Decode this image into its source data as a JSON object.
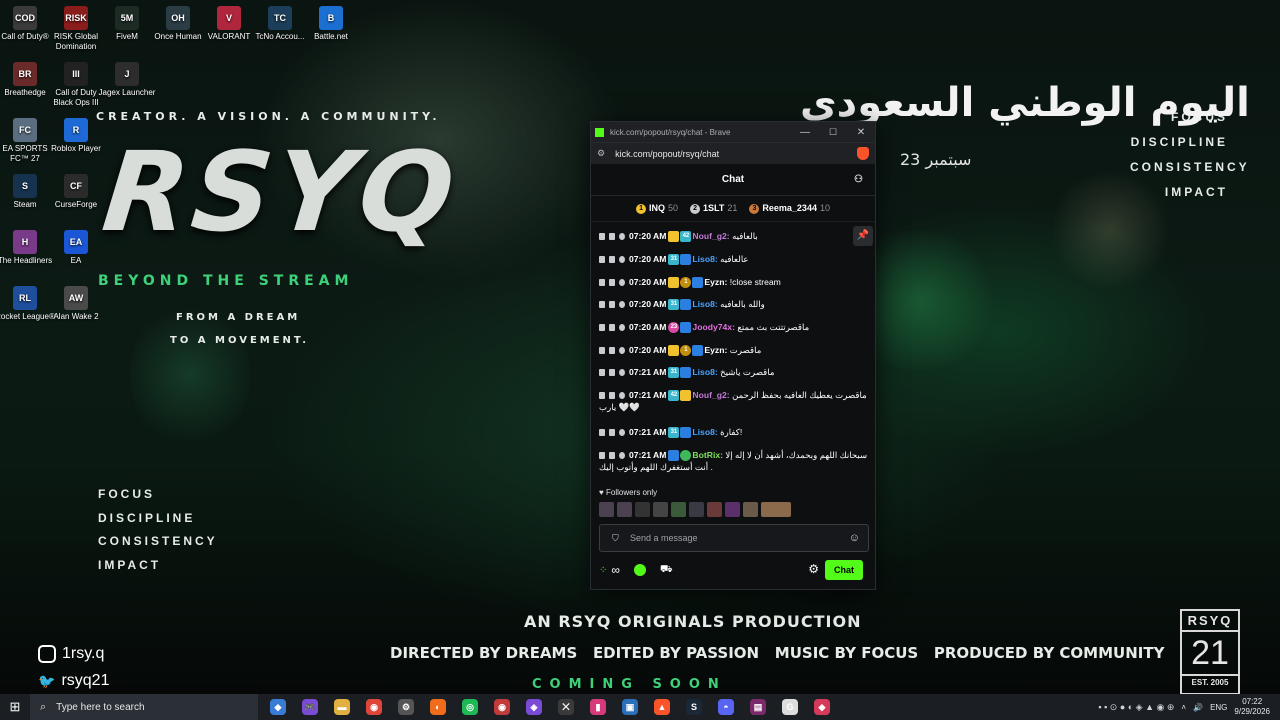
{
  "desktop": {
    "icons": [
      {
        "label": "Call of Duty®",
        "short": "COD",
        "color": "#3a3a3a"
      },
      {
        "label": "RISK Global Domination",
        "short": "RISK",
        "color": "#8a1c1c"
      },
      {
        "label": "FiveM",
        "short": "5M",
        "color": "#1d2b24"
      },
      {
        "label": "Once Human",
        "short": "OH",
        "color": "#2a3c44"
      },
      {
        "label": "VALORANT",
        "short": "V",
        "color": "#b0263c"
      },
      {
        "label": "TcNo Accou...",
        "short": "TC",
        "color": "#1c3e5a"
      },
      {
        "label": "Battle.net",
        "short": "B",
        "color": "#1b6fd1"
      },
      {
        "label": "Breathedge",
        "short": "BR",
        "color": "#6b2a2a"
      },
      {
        "label": "Call of Duty Black Ops III",
        "short": "III",
        "color": "#222"
      },
      {
        "label": "Jagex Launcher",
        "short": "J",
        "color": "#2d2d2d"
      },
      {
        "label": "EA SPORTS FC™ 27",
        "short": "FC",
        "color": "#5b6d80"
      },
      {
        "label": "Roblox Player",
        "short": "R",
        "color": "#1e69d6"
      },
      {
        "label": "Steam",
        "short": "S",
        "color": "#17324f"
      },
      {
        "label": "CurseForge",
        "short": "CF",
        "color": "#2b2b2b"
      },
      {
        "label": "The Headliners",
        "short": "H",
        "color": "#7a3a8a"
      },
      {
        "label": "EA",
        "short": "EA",
        "color": "#1a56d6"
      },
      {
        "label": "Rocket League®",
        "short": "RL",
        "color": "#1f4e9c"
      },
      {
        "label": "Alan Wake 2",
        "short": "AW",
        "color": "#4a4a4a"
      }
    ]
  },
  "poster": {
    "tagline": "CREATOR. A VISION. A COMMUNITY.",
    "logo": "RSYQ",
    "subtitle": "BEYOND THE STREAM",
    "dream1": "FROM A DREAM",
    "dream2": "TO A MOVEMENT.",
    "values_left": [
      "FOCUS",
      "DISCIPLINE",
      "CONSISTENCY",
      "IMPACT"
    ],
    "values_right": [
      "FOCUS",
      "DISCIPLINE",
      "CONSISTENCY",
      "IMPACT"
    ],
    "arabic_title": "اليوم الوطني السعودي",
    "arabic_date": "23 سبتمبر",
    "production": "AN RSYQ ORIGINALS PRODUCTION",
    "credits": "DIRECTED BY DREAMS   EDITED BY PASSION   MUSIC BY FOCUS   PRODUCED BY COMMUNITY",
    "coming": "COMING SOON",
    "badge_top": "RSYQ",
    "badge_num": "21",
    "badge_est": "EST. 2005",
    "instagram": "1rsy.q",
    "twitter": "rsyq21"
  },
  "browser": {
    "title": "kick.com/popout/rsyq/chat - Brave",
    "url": "kick.com/popout/rsyq/chat",
    "chat_title": "Chat",
    "leaderboard": [
      {
        "rank": "1",
        "name": "INQ",
        "count": "50",
        "color": "#f2c12e"
      },
      {
        "rank": "2",
        "name": "1SLT",
        "count": "21",
        "color": "#c9ccd0"
      },
      {
        "rank": "3",
        "name": "Reema_2344",
        "count": "10",
        "color": "#c97a3a"
      }
    ],
    "messages": [
      {
        "time": "07:20 AM",
        "badges": [
          "crown",
          "sub:42"
        ],
        "user": "Nouf_g2:",
        "color": "#c27ad6",
        "text": "بالعافيه"
      },
      {
        "time": "07:20 AM",
        "badges": [
          "sub:31",
          "blue"
        ],
        "user": "Liso8:",
        "color": "#4aa3ff",
        "text": "عالعافيه"
      },
      {
        "time": "07:20 AM",
        "badges": [
          "crown",
          "bal:1",
          "blue"
        ],
        "user": "Eyzn:",
        "color": "#ffffff",
        "text": "!close stream"
      },
      {
        "time": "07:20 AM",
        "badges": [
          "sub:31",
          "blue"
        ],
        "user": "Liso8:",
        "color": "#4aa3ff",
        "text": "والله بالعافيه"
      },
      {
        "time": "07:20 AM",
        "badges": [
          "pink:23",
          "blue"
        ],
        "user": "Joody74x:",
        "color": "#e16fe0",
        "text": "ماقصرتتتت بث ممتع"
      },
      {
        "time": "07:20 AM",
        "badges": [
          "crown",
          "bal:1",
          "blue"
        ],
        "user": "Eyzn:",
        "color": "#ffffff",
        "text": "ماقصرت"
      },
      {
        "time": "07:21 AM",
        "badges": [
          "sub:31",
          "blue"
        ],
        "user": "Liso8:",
        "color": "#4aa3ff",
        "text": "ماقصرت ياشيخ"
      },
      {
        "time": "07:21 AM",
        "badges": [
          "sub:42",
          "crown"
        ],
        "user": "Nouf_g2:",
        "color": "#c27ad6",
        "text": "ماقصرت يعطيك العافيه بحفظ الرحمن يارب 🤍🤍"
      },
      {
        "time": "07:21 AM",
        "badges": [
          "sub:31",
          "blue"
        ],
        "user": "Liso8:",
        "color": "#4aa3ff",
        "text": "كفارة!"
      },
      {
        "time": "07:21 AM",
        "badges": [
          "blue",
          "green"
        ],
        "user": "BotRix:",
        "color": "#7ee05a",
        "text": "سبحانك اللهم وبحمدك، أشهد أن لا إله إلا أنت أستغفرك اللهم وأتوب إليك ."
      }
    ],
    "followers_only": "Followers only",
    "input_placeholder": "Send a message",
    "chat_button": "Chat"
  },
  "taskbar": {
    "search_placeholder": "Type here to search",
    "lang": "ENG",
    "time": "07:22",
    "date": "9/29/2026"
  }
}
